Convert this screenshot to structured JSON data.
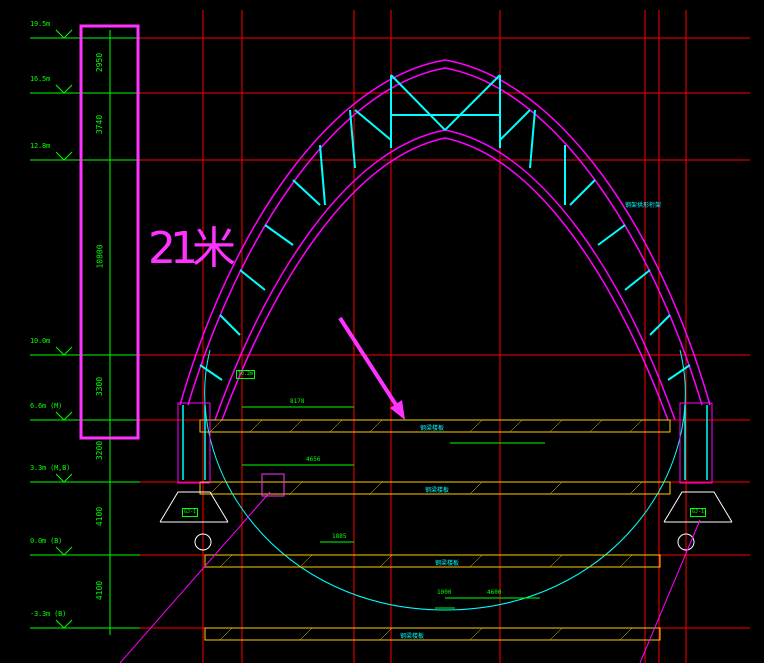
{
  "annotation": {
    "handwritten_note": "21米"
  },
  "elevations": [
    {
      "label": "19.5m"
    },
    {
      "label": "16.5m"
    },
    {
      "label": "12.8m"
    },
    {
      "label": "10.0m"
    },
    {
      "label": "6.6m (M)"
    },
    {
      "label": "3.3m (M,B)"
    },
    {
      "label": "0.0m (B)"
    },
    {
      "label": "-3.3m (B)"
    }
  ],
  "vertical_dims": [
    "2950",
    "3740",
    "10800",
    "3300",
    "3200",
    "4100",
    "4100"
  ],
  "horizontal_dims": [
    "8178",
    "4656",
    "1885",
    "4600",
    "1000"
  ],
  "labels": {
    "truss_note": "钢架拱形桁架",
    "beam_1": "钢梁楼板",
    "beam_2": "钢梁楼板",
    "beam_3": "钢梁楼板",
    "beam_4": "钢梁楼板",
    "left_col_tag": "GJ-1",
    "right_col_tag": "GJ-1",
    "elev_tag": "10.2m"
  },
  "colors": {
    "background": "#000000",
    "grid": "#ff0000",
    "arch_outer": "#ff00ff",
    "arch_member": "#00ffff",
    "dimension": "#00ff00",
    "slab": "#ffcc00",
    "highlight": "#ff33ff"
  }
}
